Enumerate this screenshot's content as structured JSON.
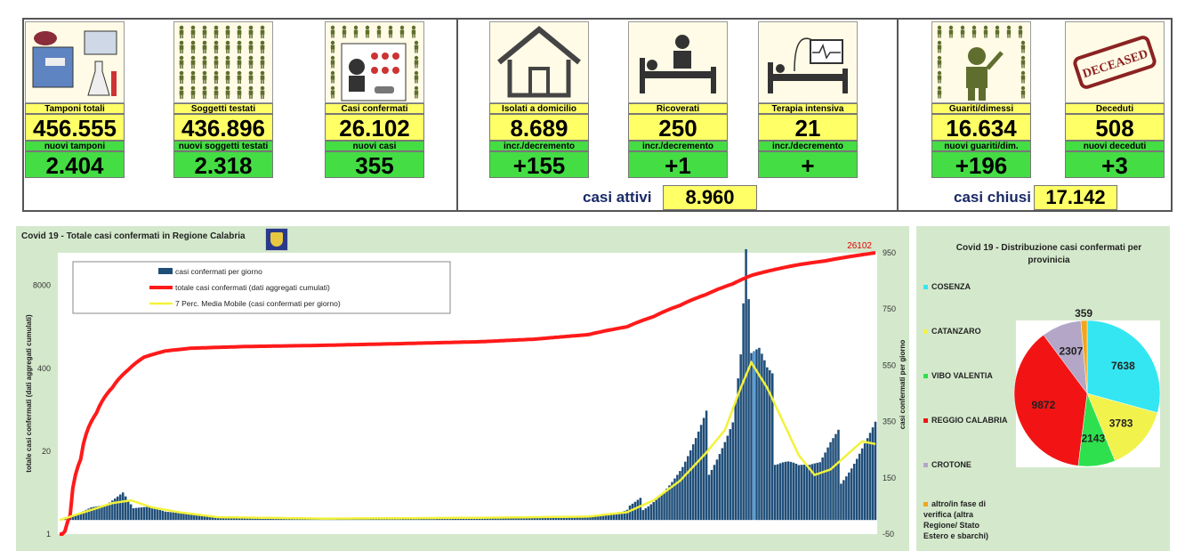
{
  "cards": [
    {
      "id": "tamponi",
      "label": "Tamponi totali",
      "value": "456.555",
      "sub_label": "nuovi tamponi",
      "sub_value": "2.404",
      "icon": "lab-equipment-icon"
    },
    {
      "id": "soggetti",
      "label": "Soggetti testati",
      "value": "436.896",
      "sub_label": "nuovi soggetti testati",
      "sub_value": "2.318",
      "icon": "people-grid-icon"
    },
    {
      "id": "casi",
      "label": "Casi confermati",
      "value": "26.102",
      "sub_label": "nuovi casi",
      "sub_value": "355",
      "icon": "virus-person-icon"
    },
    {
      "id": "isolati",
      "label": "Isolati a domicilio",
      "value": "8.689",
      "sub_label": "incr./decremento",
      "sub_value": "+155",
      "icon": "house-icon"
    },
    {
      "id": "ricoverati",
      "label": "Ricoverati",
      "value": "250",
      "sub_label": "incr./decremento",
      "sub_value": "+1",
      "icon": "hospital-bed-icon"
    },
    {
      "id": "terapia",
      "label": "Terapia intensiva",
      "value": "21",
      "sub_label": "incr./decremento",
      "sub_value": "+",
      "icon": "icu-monitor-icon"
    },
    {
      "id": "guariti",
      "label": "Guariti/dimessi",
      "value": "16.634",
      "sub_label": "nuovi guariti/dim.",
      "sub_value": "+196",
      "icon": "recovered-person-icon"
    },
    {
      "id": "deceduti",
      "label": "Deceduti",
      "value": "508",
      "sub_label": "nuovi deceduti",
      "sub_value": "+3",
      "icon": "deceased-stamp-icon"
    }
  ],
  "deceased_stamp_text": "DECEASED",
  "casi_attivi": {
    "label": "casi attivi",
    "value": "8.960"
  },
  "casi_chiusi": {
    "label": "casi chiusi",
    "value": "17.142"
  },
  "colors": {
    "yellow": "#ffff66",
    "green": "#44dd44",
    "bars": "#1f4e79",
    "cumulative": "#ff1a1a",
    "moving_avg": "#f2f23a",
    "chart_bg": "#d4e9cc"
  },
  "chart_data": [
    {
      "type": "bar+line",
      "title": "Covid 19 - Totale casi confermati in Regione Calabria",
      "ylabel_left": "totale casi confermati (dati aggregati cumulati)",
      "ylabel_right": "casi confermati per giorno",
      "left_axis_ticks": [
        "1",
        "20",
        "400",
        "8000"
      ],
      "right_axis_ticks": [
        "-50",
        "150",
        "350",
        "550",
        "750",
        "950"
      ],
      "right_range": [
        -50,
        950
      ],
      "left_log_range": [
        1,
        26102
      ],
      "end_label": "26102",
      "legend": [
        "casi confermati per giorno",
        "totale casi confermati (dati aggregati cumulati)",
        "7 Perc. Media Mobile (casi confermati per giorno)"
      ],
      "n_days": 310,
      "daily_profile": [
        [
          0,
          0
        ],
        [
          6,
          18
        ],
        [
          12,
          45
        ],
        [
          18,
          55
        ],
        [
          24,
          98
        ],
        [
          28,
          42
        ],
        [
          34,
          48
        ],
        [
          40,
          30
        ],
        [
          48,
          22
        ],
        [
          60,
          8
        ],
        [
          80,
          5
        ],
        [
          100,
          5
        ],
        [
          120,
          4
        ],
        [
          140,
          6
        ],
        [
          160,
          8
        ],
        [
          180,
          10
        ],
        [
          200,
          14
        ],
        [
          212,
          25
        ],
        [
          220,
          55
        ],
        [
          228,
          110
        ],
        [
          236,
          170
        ],
        [
          244,
          260
        ],
        [
          250,
          330
        ],
        [
          255,
          390
        ],
        [
          258,
          590
        ],
        [
          260,
          900
        ],
        [
          262,
          520
        ],
        [
          265,
          490
        ],
        [
          268,
          400
        ],
        [
          272,
          330
        ],
        [
          276,
          280
        ],
        [
          280,
          220
        ],
        [
          284,
          190
        ],
        [
          288,
          175
        ],
        [
          292,
          210
        ],
        [
          296,
          230
        ],
        [
          300,
          260
        ],
        [
          304,
          300
        ],
        [
          309,
          340
        ]
      ],
      "cumulative_profile": [
        [
          0,
          0.2
        ],
        [
          4,
          2
        ],
        [
          8,
          15
        ],
        [
          14,
          80
        ],
        [
          20,
          200
        ],
        [
          26,
          380
        ],
        [
          32,
          600
        ],
        [
          40,
          750
        ],
        [
          50,
          830
        ],
        [
          70,
          880
        ],
        [
          100,
          920
        ],
        [
          130,
          980
        ],
        [
          160,
          1050
        ],
        [
          180,
          1150
        ],
        [
          200,
          1350
        ],
        [
          215,
          1800
        ],
        [
          225,
          2600
        ],
        [
          235,
          3900
        ],
        [
          245,
          5800
        ],
        [
          255,
          8500
        ],
        [
          262,
          11500
        ],
        [
          270,
          14000
        ],
        [
          280,
          17000
        ],
        [
          290,
          19500
        ],
        [
          300,
          23000
        ],
        [
          309,
          26102
        ]
      ],
      "moving_avg_profile": [
        [
          0,
          0
        ],
        [
          10,
          30
        ],
        [
          20,
          60
        ],
        [
          27,
          70
        ],
        [
          35,
          45
        ],
        [
          45,
          28
        ],
        [
          60,
          10
        ],
        [
          100,
          5
        ],
        [
          160,
          8
        ],
        [
          200,
          12
        ],
        [
          215,
          28
        ],
        [
          225,
          70
        ],
        [
          235,
          140
        ],
        [
          245,
          240
        ],
        [
          252,
          320
        ],
        [
          258,
          470
        ],
        [
          262,
          560
        ],
        [
          268,
          470
        ],
        [
          274,
          350
        ],
        [
          280,
          230
        ],
        [
          286,
          160
        ],
        [
          292,
          180
        ],
        [
          298,
          230
        ],
        [
          304,
          280
        ],
        [
          309,
          270
        ]
      ]
    },
    {
      "type": "pie",
      "title": "Covid 19 - Distribuzione casi confermati per provinicia",
      "slices": [
        {
          "name": "COSENZA",
          "value": 7638,
          "color": "#33e6f2"
        },
        {
          "name": "CATANZARO",
          "value": 3783,
          "color": "#f2f24d"
        },
        {
          "name": "VIBO VALENTIA",
          "value": 2143,
          "color": "#2ee04d"
        },
        {
          "name": "REGGIO CALABRIA",
          "value": 9872,
          "color": "#f21414"
        },
        {
          "name": "CROTONE",
          "value": 2307,
          "color": "#b3a6c7"
        },
        {
          "name": "altro/in fase di verifica (altra Regione/ Stato Estero e sbarchi)",
          "value": 359,
          "color": "#f2a61a"
        }
      ]
    }
  ]
}
